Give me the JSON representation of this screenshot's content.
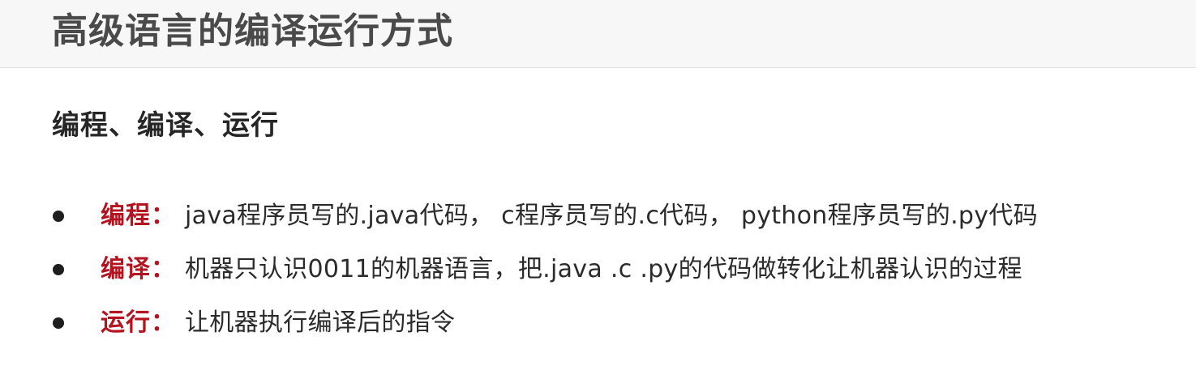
{
  "title": "高级语言的编译运行方式",
  "section": {
    "heading": "编程、编译、运行"
  },
  "items": [
    {
      "term": "编程：",
      "desc": "java程序员写的.java代码， c程序员写的.c代码， python程序员写的.py代码"
    },
    {
      "term": "编译：",
      "desc": "机器只认识0011的机器语言，把.java .c .py的代码做转化让机器认识的过程"
    },
    {
      "term": "运行：",
      "desc": "让机器执行编译后的指令"
    }
  ],
  "colors": {
    "term": "#b3141f",
    "title": "#4a4a4a",
    "title_bar_bg": "#f7f7f7",
    "text": "#2b2b2b"
  }
}
